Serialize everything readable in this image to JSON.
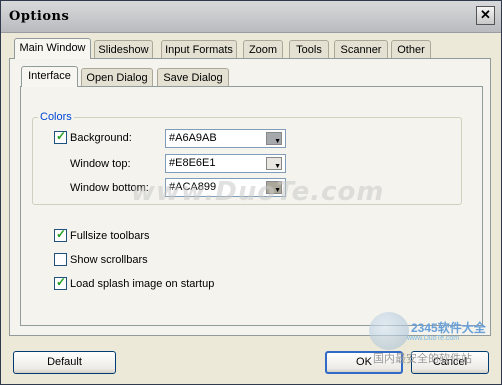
{
  "window": {
    "title": "Options",
    "close_glyph": "✕"
  },
  "tabs": [
    "Main Window",
    "Slideshow",
    "Input Formats",
    "Zoom",
    "Tools",
    "Scanner",
    "Other"
  ],
  "subtabs": [
    "Interface",
    "Open Dialog",
    "Save Dialog"
  ],
  "colors_group": {
    "legend": "Colors",
    "background": {
      "label": "Background:",
      "checked": true,
      "value": "#A6A9AB",
      "swatch": "#A6A9AB"
    },
    "window_top": {
      "label": "Window top:",
      "value": "#E8E6E1",
      "swatch": "#E8E6E1"
    },
    "window_bottom": {
      "label": "Window bottom:",
      "value": "#ACA899",
      "swatch": "#ACA899"
    }
  },
  "options": {
    "fullsize_toolbars": {
      "label": "Fullsize toolbars",
      "checked": true
    },
    "show_scrollbars": {
      "label": "Show scrollbars",
      "checked": false
    },
    "splash": {
      "label": "Load splash image on startup",
      "checked": true
    }
  },
  "buttons": {
    "default": "Default",
    "ok": "OK",
    "cancel": "Cancel"
  },
  "watermark": {
    "main": "www.DuoTe.com",
    "logo_text": "2345软件大全",
    "logo_url": "www.DuoTe.com",
    "footer": "国内最安全的软件站"
  },
  "icons": {
    "check": "✓",
    "dropdown": "▼"
  }
}
